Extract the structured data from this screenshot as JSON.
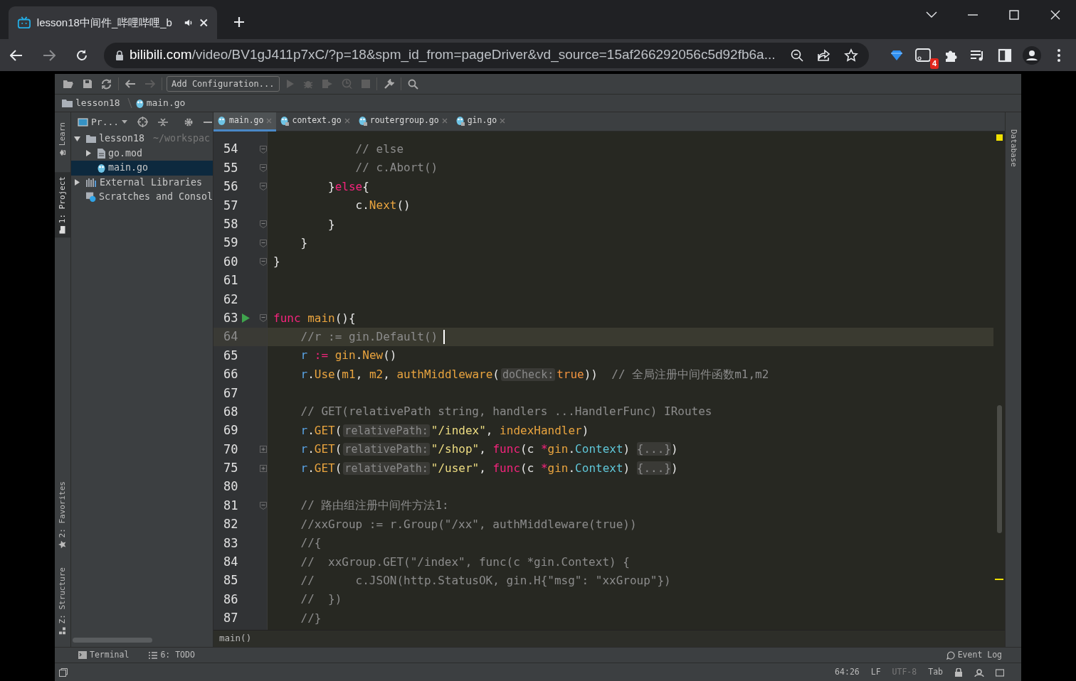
{
  "browser": {
    "tab": {
      "title": "lesson18中间件_哔哩哔哩_b",
      "audio": true,
      "selected": true
    },
    "url": {
      "domain": "bilibili.com",
      "path": "/video/BV1gJ411p7xC/?p=18&spm_id_from=pageDriver&vd_source=15af266292056c5d92fb6a..."
    },
    "extension_badge": "4"
  },
  "ide": {
    "run_configuration": "Add Configuration...",
    "breadcrumb": [
      "lesson18",
      "main.go"
    ],
    "left_stripe": [
      {
        "label": "Learn",
        "kind": "learn",
        "selected": false
      },
      {
        "label": "1: Project",
        "kind": "project",
        "selected": true
      }
    ],
    "left_stripe_bottom": [
      {
        "label": "2: Favorites",
        "kind": "favorites",
        "selected": false
      },
      {
        "label": "Z: Structure",
        "kind": "structure",
        "selected": false
      }
    ],
    "project_panel": {
      "title": "Pr...",
      "tree": [
        {
          "label": "lesson18",
          "detail": "~/workspac",
          "kind": "folder",
          "expanded": true,
          "selected": false,
          "children": [
            {
              "label": "go.mod",
              "kind": "file",
              "expanded": false,
              "selected": false
            },
            {
              "label": "main.go",
              "kind": "go",
              "selected": true
            }
          ]
        },
        {
          "label": "External Libraries",
          "kind": "libraries",
          "expanded": false,
          "selected": false
        },
        {
          "label": "Scratches and Consol",
          "kind": "scratches",
          "selected": false
        }
      ]
    },
    "editor_tabs": [
      {
        "label": "main.go",
        "selected": true,
        "locked": false
      },
      {
        "label": "context.go",
        "selected": false,
        "locked": true
      },
      {
        "label": "routergroup.go",
        "selected": false,
        "locked": true
      },
      {
        "label": "gin.go",
        "selected": false,
        "locked": true
      }
    ],
    "code_lines": [
      {
        "number": "54",
        "collapsed": false,
        "run": false,
        "current": false,
        "tokens": [
          {
            "kind": "comment",
            "text": "            // else"
          }
        ]
      },
      {
        "number": "55",
        "collapsed": false,
        "run": false,
        "current": false,
        "tokens": [
          {
            "kind": "comment",
            "text": "            // c.Abort()"
          }
        ]
      },
      {
        "number": "56",
        "collapsed": false,
        "run": false,
        "current": false,
        "tokens": [
          {
            "kind": "plain",
            "text": "        }"
          },
          {
            "kind": "keyword",
            "text": "else"
          },
          {
            "kind": "plain",
            "text": "{"
          }
        ]
      },
      {
        "number": "57",
        "run": false,
        "current": false,
        "tokens": [
          {
            "kind": "plain",
            "text": "            c."
          },
          {
            "kind": "function",
            "text": "Next"
          },
          {
            "kind": "plain",
            "text": "()"
          }
        ]
      },
      {
        "number": "58",
        "collapsed": false,
        "run": false,
        "current": false,
        "tokens": [
          {
            "kind": "plain",
            "text": "        }"
          }
        ]
      },
      {
        "number": "59",
        "collapsed": false,
        "run": false,
        "current": false,
        "tokens": [
          {
            "kind": "plain",
            "text": "    }"
          }
        ]
      },
      {
        "number": "60",
        "collapsed": false,
        "run": false,
        "current": false,
        "tokens": [
          {
            "kind": "plain",
            "text": "}"
          }
        ]
      },
      {
        "number": "61",
        "run": false,
        "current": false
      },
      {
        "number": "62",
        "run": false,
        "current": false
      },
      {
        "number": "63",
        "collapsed": false,
        "run": true,
        "current": false,
        "tokens": [
          {
            "kind": "keyword",
            "text": "func"
          },
          {
            "kind": "function",
            "text": "main"
          },
          {
            "kind": "plain",
            "text": "(){"
          }
        ]
      },
      {
        "number": "64",
        "run": false,
        "current": true,
        "tokens": [
          {
            "kind": "comment",
            "text": "    //r := gin.Default()"
          }
        ]
      },
      {
        "number": "65",
        "run": false,
        "current": false,
        "tokens": [
          {
            "kind": "variable",
            "text": "    r"
          },
          {
            "kind": "operator",
            "text": ":="
          },
          {
            "kind": "function",
            "text": "gin"
          },
          {
            "kind": "plain",
            "text": "."
          },
          {
            "kind": "function",
            "text": "New"
          },
          {
            "kind": "plain",
            "text": "()"
          }
        ]
      },
      {
        "number": "66",
        "run": false,
        "current": false,
        "tokens": [
          {
            "kind": "variable",
            "text": "    r"
          },
          {
            "kind": "plain",
            "text": "."
          },
          {
            "kind": "function",
            "text": "Use"
          },
          {
            "kind": "plain",
            "text": "("
          },
          {
            "kind": "function",
            "text": "m1"
          },
          {
            "kind": "plain",
            "text": ","
          },
          {
            "kind": "function",
            "text": "m2"
          },
          {
            "kind": "plain",
            "text": ","
          },
          {
            "kind": "function",
            "text": "authMiddleware"
          },
          {
            "kind": "plain",
            "text": "("
          },
          {
            "kind": "hint",
            "text": "doCheck:"
          },
          {
            "kind": "constant",
            "text": "true"
          },
          {
            "kind": "plain",
            "text": "))"
          },
          {
            "kind": "comment",
            "text": "// 全局注册中间件函数m1,m2"
          }
        ]
      },
      {
        "number": "67",
        "run": false,
        "current": false
      },
      {
        "number": "68",
        "run": false,
        "current": false,
        "tokens": [
          {
            "kind": "comment",
            "text": "    // GET(relativePath string, handlers ...HandlerFunc) IRoutes"
          }
        ]
      },
      {
        "number": "69",
        "run": false,
        "current": false,
        "tokens": [
          {
            "kind": "variable",
            "text": "    r"
          },
          {
            "kind": "plain",
            "text": "."
          },
          {
            "kind": "function",
            "text": "GET"
          },
          {
            "kind": "plain",
            "text": "("
          },
          {
            "kind": "hint",
            "text": "relativePath:"
          },
          {
            "kind": "string",
            "text": "\"/index\""
          },
          {
            "kind": "plain",
            "text": ","
          },
          {
            "kind": "function",
            "text": "indexHandler"
          },
          {
            "kind": "plain",
            "text": ")"
          }
        ]
      },
      {
        "number": "70",
        "collapsed": true,
        "run": false,
        "current": false,
        "tokens": [
          {
            "kind": "variable",
            "text": "    r"
          },
          {
            "kind": "plain",
            "text": "."
          },
          {
            "kind": "function",
            "text": "GET"
          },
          {
            "kind": "plain",
            "text": "("
          },
          {
            "kind": "hint",
            "text": "relativePath:"
          },
          {
            "kind": "string",
            "text": "\"/shop\""
          },
          {
            "kind": "plain",
            "text": ","
          },
          {
            "kind": "keyword",
            "text": "func"
          },
          {
            "kind": "plain",
            "text": "(c"
          },
          {
            "kind": "operator",
            "text": "*"
          },
          {
            "kind": "function",
            "text": "gin"
          },
          {
            "kind": "plain",
            "text": "."
          },
          {
            "kind": "type",
            "text": "Context"
          },
          {
            "kind": "plain",
            "text": ")"
          },
          {
            "kind": "folded",
            "text": "{...}"
          },
          {
            "kind": "plain",
            "text": ")"
          }
        ]
      },
      {
        "number": "75",
        "collapsed": true,
        "run": false,
        "current": false,
        "tokens": [
          {
            "kind": "variable",
            "text": "    r"
          },
          {
            "kind": "plain",
            "text": "."
          },
          {
            "kind": "function",
            "text": "GET"
          },
          {
            "kind": "plain",
            "text": "("
          },
          {
            "kind": "hint",
            "text": "relativePath:"
          },
          {
            "kind": "string",
            "text": "\"/user\""
          },
          {
            "kind": "plain",
            "text": ","
          },
          {
            "kind": "keyword",
            "text": "func"
          },
          {
            "kind": "plain",
            "text": "(c"
          },
          {
            "kind": "operator",
            "text": "*"
          },
          {
            "kind": "function",
            "text": "gin"
          },
          {
            "kind": "plain",
            "text": "."
          },
          {
            "kind": "type",
            "text": "Context"
          },
          {
            "kind": "plain",
            "text": ")"
          },
          {
            "kind": "folded",
            "text": "{...}"
          },
          {
            "kind": "plain",
            "text": ")"
          }
        ]
      },
      {
        "number": "80",
        "run": false,
        "current": false
      },
      {
        "number": "81",
        "collapsed": false,
        "run": false,
        "current": false,
        "tokens": [
          {
            "kind": "comment",
            "text": "    // 路由组注册中间件方法1:"
          }
        ]
      },
      {
        "number": "82",
        "run": false,
        "current": false,
        "tokens": [
          {
            "kind": "comment",
            "text": "    //xxGroup := r.Group(\"/xx\", authMiddleware(true))"
          }
        ]
      },
      {
        "number": "83",
        "run": false,
        "current": false,
        "tokens": [
          {
            "kind": "comment",
            "text": "    //{"
          }
        ]
      },
      {
        "number": "84",
        "run": false,
        "current": false,
        "tokens": [
          {
            "kind": "comment",
            "text": "    //  xxGroup.GET(\"/index\", func(c *gin.Context) {"
          }
        ]
      },
      {
        "number": "85",
        "run": false,
        "current": false,
        "tokens": [
          {
            "kind": "comment",
            "text": "    //      c.JSON(http.StatusOK, gin.H{\"msg\": \"xxGroup\"})"
          }
        ]
      },
      {
        "number": "86",
        "run": false,
        "current": false,
        "tokens": [
          {
            "kind": "comment",
            "text": "    //  })"
          }
        ]
      },
      {
        "number": "87",
        "run": false,
        "current": false,
        "tokens": [
          {
            "kind": "comment",
            "text": "    //}"
          }
        ]
      }
    ],
    "code_breadcrumb": "main()",
    "right_stripe": [
      {
        "label": "Database",
        "selected": false
      }
    ],
    "tool_windows": [
      {
        "label": "Terminal",
        "kind": "terminal"
      },
      {
        "label": "6: TODO",
        "kind": "todo"
      }
    ],
    "event_log": "Event Log",
    "status": [
      {
        "text": "64:26",
        "dim": false
      },
      {
        "text": "LF",
        "dim": false
      },
      {
        "text": "UTF-8",
        "dim": true
      },
      {
        "text": "Tab",
        "dim": false
      }
    ]
  }
}
